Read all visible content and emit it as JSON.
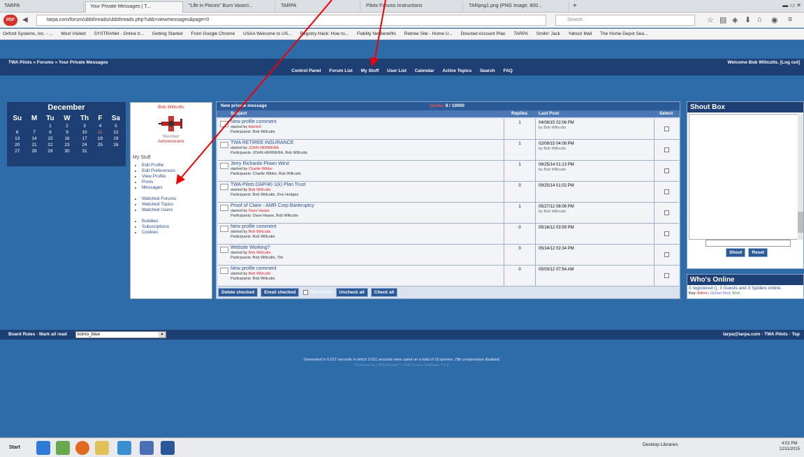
{
  "browser": {
    "tabs": [
      {
        "label": "TARPA"
      },
      {
        "label": "Your Private Messages | T..."
      },
      {
        "label": "\"Life in Pieces\" Burn Vasect..."
      },
      {
        "label": "TARPA"
      },
      {
        "label": "Pilots Forums Instructions"
      },
      {
        "label": "TARpng1.png (PNG Image, 800..."
      }
    ],
    "url": "tarpa.com/forum/ubbthreads/ubbthreads.php?ubb=viewmessages&page=0",
    "search_placeholder": "Search",
    "bookmarks": [
      "Oxford Systems, Inc. - ...",
      "Most Visited",
      "SYSTRANet - Online tr...",
      "Getting Started",
      "From Google Chrome",
      "USAA Welcome to US...",
      "Registry Hack: How to...",
      "Fidelity NetBenefits",
      "Retiree Site - Home U...",
      "Directed Account Plan",
      "TARPA",
      "Smilin' Jack",
      "Yahoo! Mail",
      "The Home Depot Sea..."
    ]
  },
  "forum": {
    "breadcrumb": "TWA Pilots » Forums » Your Private Messages",
    "welcome": "Welcome Bob Willcutts. [Log out]",
    "menu": [
      "Control Panel",
      "Forum List",
      "My Stuff",
      "User List",
      "Calendar",
      "Active Topics",
      "Search",
      "FAQ"
    ]
  },
  "calendar": {
    "month": "December",
    "days": [
      "Su",
      "M",
      "Tu",
      "W",
      "Th",
      "F",
      "Sa"
    ],
    "weeks": [
      [
        "",
        "",
        "1",
        "2",
        "3",
        "4",
        "5"
      ],
      [
        "6",
        "7",
        "8",
        "9",
        "10",
        "11",
        "12"
      ],
      [
        "13",
        "14",
        "15",
        "16",
        "17",
        "18",
        "19"
      ],
      [
        "20",
        "21",
        "22",
        "23",
        "24",
        "25",
        "26"
      ],
      [
        "27",
        "28",
        "29",
        "30",
        "31",
        "",
        ""
      ]
    ],
    "highlight_day": "11"
  },
  "user": {
    "name": "Bob Willcutts",
    "role": "Member",
    "role2": "Administrator",
    "mystuff_heading": "My Stuff",
    "links1": [
      "Edit Profile",
      "Edit Preferences",
      "View Profile",
      "Posts",
      "Messages"
    ],
    "links2": [
      "Watched Forums",
      "Watched Topics",
      "Watched Users"
    ],
    "links3": [
      "Buddies",
      "Subscriptions",
      "Cookies"
    ]
  },
  "messages": {
    "title": "New private message",
    "quota_label": "Quota:",
    "quota_value": "8 / 10000",
    "columns": {
      "subject": "Subject",
      "replies": "Replies",
      "last_post": "Last Post",
      "select": "Select"
    },
    "rows": [
      {
        "subject": "New profile comment",
        "started_prefix": "started by",
        "started_by": "Admin5",
        "participants": "Participants: Bob Willcutts",
        "replies": "1",
        "date": "04/08/15 02:06 PM",
        "by": "by Bob Willcutts"
      },
      {
        "subject": "TWA RETIREE INSURANCE",
        "started_prefix": "started by",
        "started_by": "JOHN HERRERA",
        "participants": "Participants: JOHN HERRERA, Bob Willcutts",
        "replies": "1",
        "date": "02/09/15 04:08 PM",
        "by": "by Bob Willcutts"
      },
      {
        "subject": "Jerry Richards-Flown West",
        "started_prefix": "started by",
        "started_by": "Charlie Wilder",
        "participants": "Participants: Charlie Wilder, Bob Willcutts",
        "replies": "1",
        "date": "09/25/14 01:13 PM",
        "by": "by Bob Willcutts"
      },
      {
        "subject": "TWA Pilots DAP/40 1(k) Plan Trust",
        "started_prefix": "started by",
        "started_by": "Bob Willcutts",
        "participants": "Participants: Bob Willcutts, Don Hodges",
        "replies": "0",
        "date": "09/25/14 01:02 PM",
        "by": ""
      },
      {
        "subject": "Proof of Claim - AMR Corp Bankruptcy",
        "started_prefix": "started by",
        "started_by": "Dave Haase",
        "participants": "Participants: Dave Haase, Bob Willcutts",
        "replies": "1",
        "date": "05/27/12 08:06 PM",
        "by": "by Bob Willcutts"
      },
      {
        "subject": "New profile comment",
        "started_prefix": "started by",
        "started_by": "Bob Willcutts",
        "participants": "Participants: Bob Willcutts",
        "replies": "0",
        "date": "05/16/12 03:59 PM",
        "by": ""
      },
      {
        "subject": "Website Working?",
        "started_prefix": "started by",
        "started_by": "Bob Willcutts",
        "participants": "Participants: Bob Willcutts, Tim",
        "replies": "0",
        "date": "05/14/12 02:34 PM",
        "by": ""
      },
      {
        "subject": "New profile comment",
        "started_prefix": "started by",
        "started_by": "Bob Willcutts",
        "participants": "Participants: Bob Willcutts",
        "replies": "0",
        "date": "05/03/12 07:54 AM",
        "by": ""
      }
    ],
    "actions": {
      "delete": "Delete checked",
      "email": "Email checked",
      "then_delete": "then delete",
      "uncheck": "Uncheck all",
      "check": "Check all"
    }
  },
  "shoutbox": {
    "title": "Shout Box",
    "shout": "Shout",
    "reset": "Reset"
  },
  "online": {
    "title": "Who's Online",
    "text": "0 registered (), 3 Guests and 3 Spiders online.",
    "key_label": "Key:",
    "key_admin": "Admin",
    "key_global": "Global Mod",
    "key_mod": "Mod"
  },
  "footer": {
    "left": "Board Rules · Mark all read",
    "theme": "konro_blue",
    "right": "tarpa@tarpa.com · TWA Pilots · Top"
  },
  "generated": "Generated in 0.027 seconds in which 0.011 seconds were spent on a total of 16 queries. Zlib compression disabled.",
  "powered": "Powered by UBB.threads™ PHP Forum Software 7.5.8",
  "taskbar": {
    "start": "Start",
    "desktop": "Desktop",
    "libraries": "Libraries",
    "time": "4:02 PM",
    "date": "12/11/2015"
  }
}
